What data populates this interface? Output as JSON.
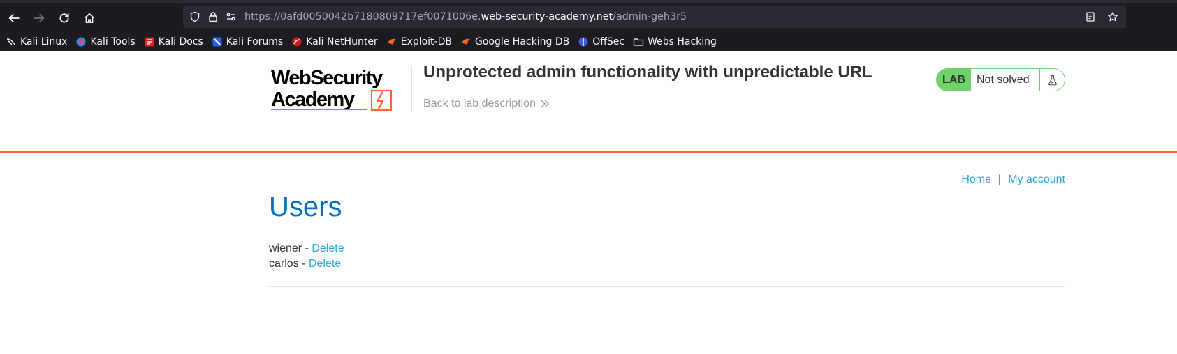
{
  "browser": {
    "url_prefix": "https://0afd0050042b7180809717ef0071006e.",
    "url_host": "web-security-academy.net",
    "url_path": "/admin-geh3r5",
    "bookmarks": [
      {
        "label": "Kali Linux",
        "icon": "kali-dragon-icon"
      },
      {
        "label": "Kali Tools",
        "icon": "kali-tools-icon"
      },
      {
        "label": "Kali Docs",
        "icon": "kali-docs-icon"
      },
      {
        "label": "Kali Forums",
        "icon": "kali-forums-icon"
      },
      {
        "label": "Kali NetHunter",
        "icon": "kali-nethunter-icon"
      },
      {
        "label": "Exploit-DB",
        "icon": "exploit-db-icon"
      },
      {
        "label": "Google Hacking DB",
        "icon": "google-hacking-db-icon"
      },
      {
        "label": "OffSec",
        "icon": "offsec-icon"
      },
      {
        "label": "Webs Hacking",
        "icon": "folder-icon"
      }
    ]
  },
  "header": {
    "logo_line1": "WebSecurity",
    "logo_line2": "Academy",
    "lab_title": "Unprotected admin functionality with unpredictable URL",
    "back_link": "Back to lab description",
    "lab_tag": "LAB",
    "lab_state": "Not solved"
  },
  "nav": {
    "home": "Home",
    "separator": "|",
    "my_account": "My account"
  },
  "main": {
    "heading": "Users",
    "users": [
      {
        "name": "wiener",
        "dash": " - ",
        "action": "Delete"
      },
      {
        "name": "carlos",
        "dash": " - ",
        "action": "Delete"
      }
    ]
  },
  "colors": {
    "accent_orange": "#ff6633",
    "heading_blue": "#0071bc",
    "link_blue": "#29a7e1",
    "lab_green": "#70d16d"
  }
}
